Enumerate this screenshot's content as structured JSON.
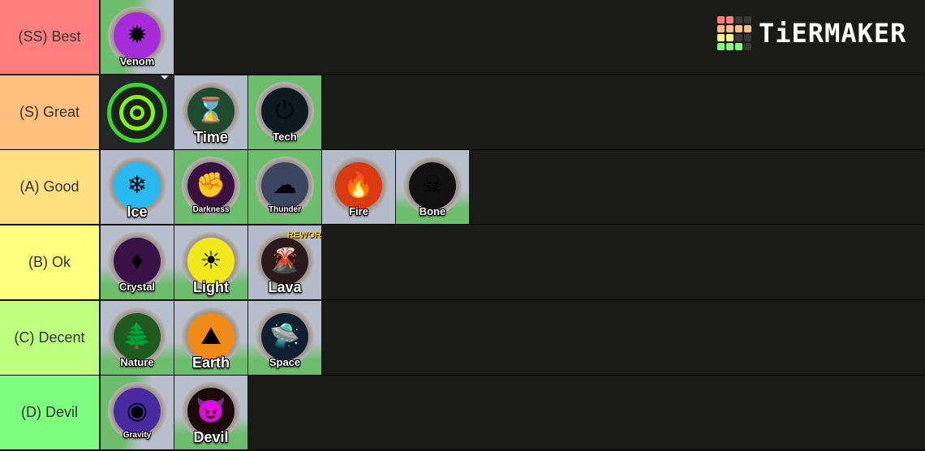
{
  "logo": {
    "text": "TiERMAKER",
    "grid_colors": [
      [
        "#ff7f7f",
        "#ff7f7f",
        "#3a3a3a",
        "#3a3a3a"
      ],
      [
        "#ffbf7f",
        "#ffbf7f",
        "#ffbf7f",
        "#ffbf7f"
      ],
      [
        "#ffff7f",
        "#ffff7f",
        "#3a3a3a",
        "#3a3a3a"
      ],
      [
        "#7fff7f",
        "#7fff7f",
        "#7fff7f",
        "#3a3a3a"
      ]
    ]
  },
  "tiers": [
    {
      "label": "(SS) Best",
      "color": "#ff7f7f",
      "items": [
        {
          "name": "Venom",
          "icon": "venom-icon",
          "bg": "bg-mix",
          "disc": "#a62bd9",
          "glyph": "✹",
          "size": "normal"
        }
      ]
    },
    {
      "label": "(S) Great",
      "color": "#ffbf7f",
      "items": [
        {
          "name": "",
          "icon": "target-icon",
          "bg": "bg-dark",
          "special": "target"
        },
        {
          "name": "Time",
          "icon": "hourglass-icon",
          "bg": "bg-grey",
          "disc": "#1f4a2e",
          "glyph": "⌛",
          "size": "big"
        },
        {
          "name": "Tech",
          "icon": "power-icon",
          "bg": "bg-green",
          "disc": "#0d1a22",
          "glyph": "⏻",
          "size": "normal"
        }
      ]
    },
    {
      "label": "(A) Good",
      "color": "#ffdf7f",
      "items": [
        {
          "name": "Ice",
          "icon": "snowflake-icon",
          "bg": "bg-grey",
          "disc": "#29b8f0",
          "glyph": "❄",
          "size": "big"
        },
        {
          "name": "Darkness",
          "icon": "fist-icon",
          "bg": "bg-green",
          "disc": "#3a1240",
          "glyph": "✊",
          "size": "small"
        },
        {
          "name": "Thunder",
          "icon": "cloud-icon",
          "bg": "bg-green",
          "disc": "#3b4560",
          "glyph": "☁",
          "size": "small"
        },
        {
          "name": "Fire",
          "icon": "flame-icon",
          "bg": "bg-grey",
          "disc": "#d93a12",
          "glyph": "🔥",
          "size": "normal"
        },
        {
          "name": "Bone",
          "icon": "skull-icon",
          "bg": "bg-mix2",
          "disc": "#111111",
          "glyph": "☠",
          "size": "normal"
        }
      ]
    },
    {
      "label": "(B) Ok",
      "color": "#ffff7f",
      "items": [
        {
          "name": "Crystal",
          "icon": "crystal-icon",
          "bg": "bg-mix2",
          "disc": "#3a1248",
          "glyph": "♦",
          "size": "normal"
        },
        {
          "name": "Light",
          "icon": "sun-icon",
          "bg": "bg-mix2",
          "disc": "#f0e81a",
          "glyph": "☀",
          "size": "big"
        },
        {
          "name": "Lava",
          "icon": "volcano-icon",
          "bg": "bg-grey",
          "disc": "#2a1a1a",
          "glyph": "🌋",
          "size": "big",
          "tag": "REWOR"
        }
      ]
    },
    {
      "label": "(C) Decent",
      "color": "#bfff7f",
      "items": [
        {
          "name": "Nature",
          "icon": "tree-icon",
          "bg": "bg-mix2",
          "disc": "#1f5a1f",
          "glyph": "🌲",
          "size": "normal"
        },
        {
          "name": "Earth",
          "icon": "mountain-icon",
          "bg": "bg-mix2",
          "disc": "#f08b1a",
          "glyph": "⛰",
          "size": "big"
        },
        {
          "name": "Space",
          "icon": "ufo-icon",
          "bg": "bg-mix2",
          "disc": "#102030",
          "glyph": "🛸",
          "size": "normal"
        }
      ]
    },
    {
      "label": "(D) Devil",
      "color": "#7fff7f",
      "items": [
        {
          "name": "Gravity",
          "icon": "eye-icon",
          "bg": "bg-mix",
          "disc": "#4a2aa0",
          "glyph": "◉",
          "size": "small"
        },
        {
          "name": "Devil",
          "icon": "devil-icon",
          "bg": "bg-mix2",
          "disc": "#1a0a0a",
          "glyph": "😈",
          "size": "big"
        }
      ]
    }
  ]
}
